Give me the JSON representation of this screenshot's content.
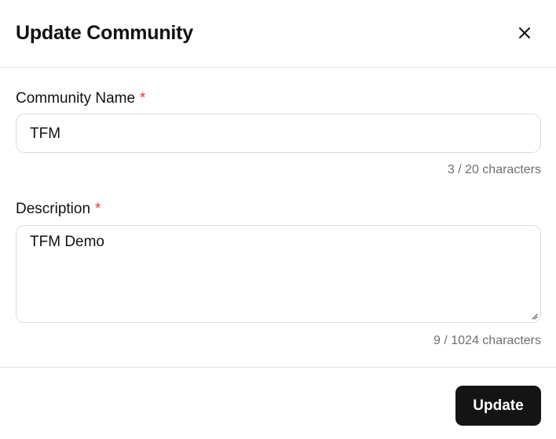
{
  "dialog": {
    "title": "Update Community",
    "close_icon": "close-icon"
  },
  "name_field": {
    "label": "Community Name",
    "required_mark": "*",
    "value": "TFM",
    "counter": "3 / 20 characters"
  },
  "description_field": {
    "label": "Description",
    "required_mark": "*",
    "value": "TFM Demo",
    "counter": "9 / 1024 characters",
    "resize_icon": "resize-handle-icon"
  },
  "footer": {
    "update_label": "Update"
  },
  "colors": {
    "required": "#e53935",
    "primary_button": "#141414",
    "border": "#dcdcdc",
    "muted_text": "#6f6f6f"
  }
}
